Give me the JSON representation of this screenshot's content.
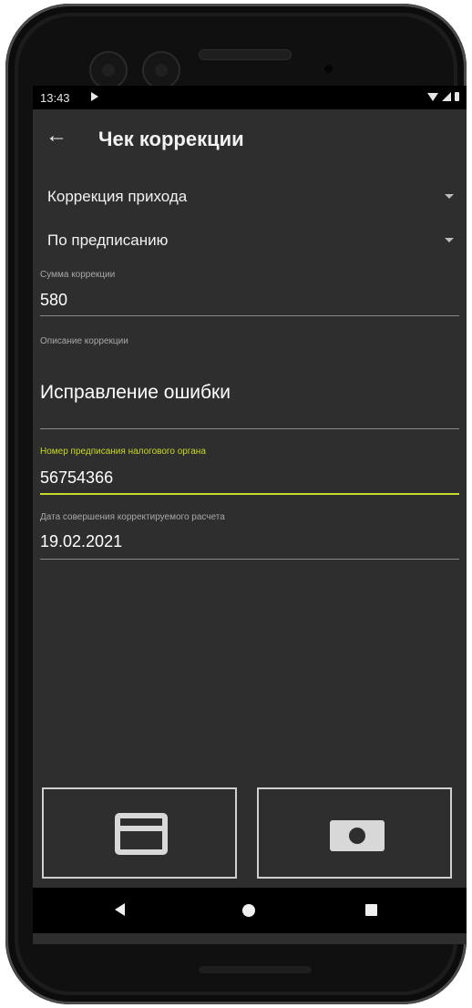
{
  "status": {
    "time": "13:43"
  },
  "header": {
    "title": "Чек коррекции"
  },
  "dropdowns": [
    {
      "label": "Коррекция прихода"
    },
    {
      "label": "По предписанию"
    }
  ],
  "fields": {
    "amount": {
      "label": "Сумма коррекции",
      "value": "580"
    },
    "description": {
      "label": "Описание коррекции",
      "value": "Исправление ошибки"
    },
    "prescription": {
      "label": "Номер предписания налогового органа",
      "value": "56754366"
    },
    "date": {
      "label": "Дата совершения корректируемого расчета",
      "value": "19.02.2021"
    }
  },
  "colors": {
    "accent": "#c8d92a",
    "background": "#2e2e2e"
  },
  "buttons": [
    {
      "icon": "credit-card-icon"
    },
    {
      "icon": "cash-icon"
    }
  ]
}
